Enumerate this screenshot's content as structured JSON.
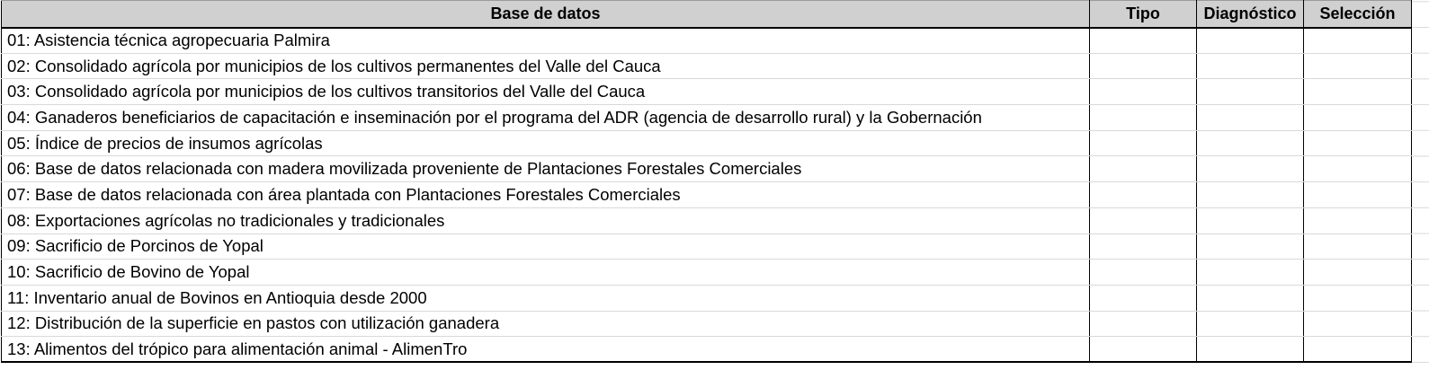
{
  "sheet": {
    "columns": {
      "base": "Base de datos",
      "tipo": "Tipo",
      "diagnostico": "Diagnóstico",
      "seleccion": "Selección"
    },
    "rows": [
      {
        "base": "01: Asistencia técnica agropecuaria Palmira",
        "tipo": "",
        "diagnostico": "",
        "seleccion": ""
      },
      {
        "base": "02: Consolidado agrícola por municipios de los cultivos permanentes del Valle del Cauca",
        "tipo": "",
        "diagnostico": "",
        "seleccion": ""
      },
      {
        "base": "03: Consolidado agrícola por municipios de los cultivos transitorios del Valle del Cauca",
        "tipo": "",
        "diagnostico": "",
        "seleccion": ""
      },
      {
        "base": "04: Ganaderos beneficiarios de capacitación e inseminación por el programa del ADR (agencia de desarrollo rural) y la Gobernación",
        "tipo": "",
        "diagnostico": "",
        "seleccion": ""
      },
      {
        "base": "05: Índice de precios de insumos agrícolas",
        "tipo": "",
        "diagnostico": "",
        "seleccion": ""
      },
      {
        "base": "06: Base de datos relacionada con madera movilizada proveniente de Plantaciones Forestales Comerciales",
        "tipo": "",
        "diagnostico": "",
        "seleccion": ""
      },
      {
        "base": "07: Base de datos relacionada con área plantada con Plantaciones Forestales Comerciales",
        "tipo": "",
        "diagnostico": "",
        "seleccion": ""
      },
      {
        "base": "08: Exportaciones agrícolas no tradicionales y tradicionales",
        "tipo": "",
        "diagnostico": "",
        "seleccion": ""
      },
      {
        "base": "09: Sacrificio de Porcinos de Yopal",
        "tipo": "",
        "diagnostico": "",
        "seleccion": ""
      },
      {
        "base": "10: Sacrificio de Bovino de Yopal",
        "tipo": "",
        "diagnostico": "",
        "seleccion": ""
      },
      {
        "base": "11: Inventario anual de Bovinos en Antioquia desde 2000",
        "tipo": "",
        "diagnostico": "",
        "seleccion": ""
      },
      {
        "base": "12: Distribución de la superficie en pastos con utilización ganadera",
        "tipo": "",
        "diagnostico": "",
        "seleccion": ""
      },
      {
        "base": "13: Alimentos del trópico para alimentación animal - AlimenTro",
        "tipo": "",
        "diagnostico": "",
        "seleccion": ""
      }
    ]
  },
  "colors": {
    "header_bg": "#d0d0d0",
    "gridline": "#d9d9d9",
    "border": "#000000"
  }
}
